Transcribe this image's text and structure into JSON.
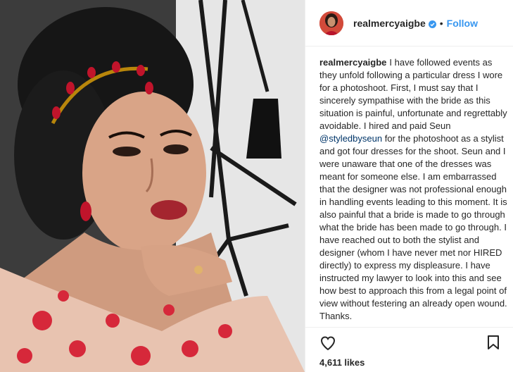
{
  "post": {
    "username": "realmercyaigbe",
    "dot": "•",
    "follow_label": "Follow",
    "caption": {
      "username": "realmercyaigbe",
      "text_before": "I have followed events as they unfold following a particular dress I wore for a photoshoot. First, I must say that I sincerely sympathise with the bride as this situation is painful, unfortunate and regrettably avoidable. I hired and paid Seun ",
      "mention": "@styledbyseun",
      "text_after": " for the photoshoot as a stylist and got four dresses for the shoot. Seun and I were unaware that one of the dresses was meant for someone else. I am embarrassed that the designer was not professional enough in handling events leading to this moment. It is also painful that a bride is made to go through what the bride has been made to go through. I have reached out to both the stylist and designer (whom I have never met nor HIRED directly) to express my displeasure. I have instructed my lawyer to look into this and see how best to approach this from a legal point of view without festering an already open wound. Thanks."
    },
    "likes": "4,611 likes"
  },
  "icons": {
    "verified": "verified-badge-icon",
    "heart": "heart-icon",
    "bookmark": "bookmark-icon"
  },
  "colors": {
    "follow": "#3897f0",
    "verified": "#3897f0",
    "dress": "#e8c3b0",
    "flowers": "#d6283a"
  }
}
